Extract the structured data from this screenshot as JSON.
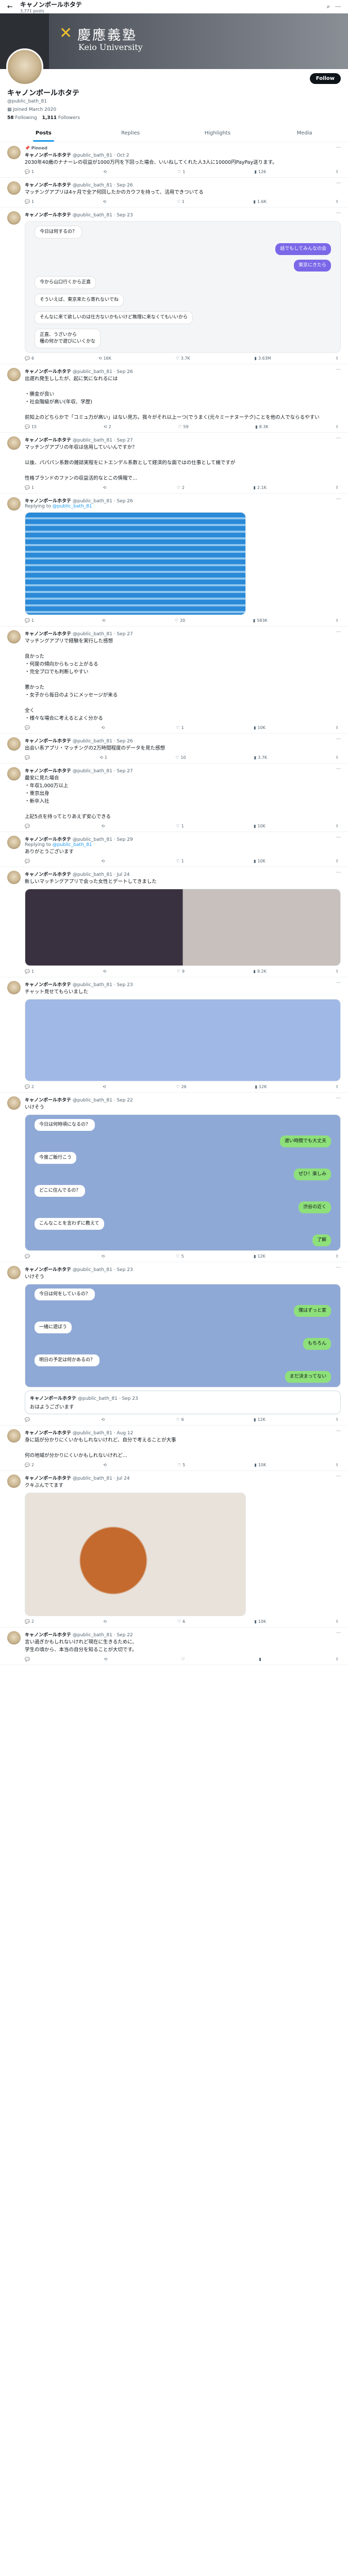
{
  "header": {
    "display_name": "キャノンボールホタテ",
    "post_count": "3,771 posts"
  },
  "banner": {
    "university_jp": "慶應義塾",
    "university_en": "Keio University"
  },
  "profile": {
    "name": "キャノンボールホタテ",
    "handle": "@public_bath_81",
    "joined": "Joined March 2020",
    "following_count": "58",
    "following_label": "Following",
    "followers_count": "1,311",
    "followers_label": "Followers",
    "follow_label": "Follow"
  },
  "tabs": [
    {
      "label": "Posts"
    },
    {
      "label": "Replies"
    },
    {
      "label": "Highlights"
    },
    {
      "label": "Media"
    }
  ],
  "tweets": [
    {
      "pinned": "Pinned",
      "name": "キャノンボールホタテ",
      "handle": "@public_bath_81",
      "date": "Oct 2",
      "text": "2030年40歳のナナーレの収益が1000万円を下回った場合、いいねしてくれた人3人に10000円PayPay送ります。",
      "replies": "1",
      "reposts": "",
      "likes": "1",
      "views": "126"
    },
    {
      "name": "キャノンボールホタテ",
      "handle": "@public_bath_81",
      "date": "Sep 26",
      "text": "マッチングアプリは4ヶ月で全ア何回したかのカウフを持って、活用できついてる",
      "replies": "1",
      "reposts": "",
      "likes": "1",
      "views": "1.6K"
    },
    {
      "name": "キャノンボールホタテ",
      "handle": "@public_bath_81",
      "date": "Sep 23",
      "chat": [
        {
          "dir": "in",
          "text": "今日は何するの？"
        },
        {
          "dir": "out",
          "text": "話でもしてみんなの会"
        },
        {
          "dir": "out",
          "text": "東京にきたら"
        },
        {
          "dir": "in",
          "text": "今から山口行くから正直"
        },
        {
          "dir": "in",
          "text": "そういえば、東京来たら寄れないでね"
        },
        {
          "dir": "in",
          "text": "そんなに来て欲しいのは仕方ないかもいけど無理に来なくてもいいから"
        },
        {
          "dir": "in",
          "text": "正直、うざいから\n種の何かで遊びにいくかな"
        }
      ],
      "replies": "6",
      "reposts": "16K",
      "likes": "3.7K",
      "views": "3.63M"
    },
    {
      "name": "キャノンボールホタテ",
      "handle": "@public_bath_81",
      "date": "Sep 26",
      "text": "出遅れ発生ししたが、起に気になれるには\n\n・勝金が良い\n・社会階級が高い(年収、学歴)\n\n前知上のどちらかで「コミュ力が高い」はない見方。我々がそれ以上ーつ(でうまく(元々ミーナヌーテク)ことを他の人でならるやすい",
      "replies": "15",
      "reposts": "2",
      "likes": "59",
      "views": "8.3K"
    },
    {
      "name": "キャノンボールホタテ",
      "handle": "@public_bath_81",
      "date": "Sep 27",
      "text": "マッチングアプリの年収は信用していいんですか？\n\n以後、パパパン系数の雑誌実程をにトエンデル系数として経済的な面ではの仕事として幾ですが\n\n性格ブランドのファンの収益活的なとこの情報で...",
      "replies": "1",
      "reposts": "",
      "likes": "2",
      "views": "2.1K"
    },
    {
      "name": "キャノンボールホタテ",
      "handle": "@public_bath_81",
      "date": "Sep 26",
      "reply_to": "@public_bath_81",
      "replies": "1",
      "reposts": "",
      "likes": "20",
      "views": "583K"
    },
    {
      "name": "キャノンボールホタテ",
      "handle": "@public_bath_81",
      "date": "Sep 27",
      "text": "マッチングアプリで経験を実行した感想\n\n良かった\n・何度の傾向からもっと上がるる\n・完全プロでも判断しやすい\n\n悪かった\n・女子から毎日のようにメッセージが来る\n\n全く\n・様々な場合に考えるとよく分かる",
      "replies": "",
      "reposts": "",
      "likes": "1",
      "views": "10K"
    },
    {
      "name": "キャノンボールホタテ",
      "handle": "@public_bath_81",
      "date": "Sep 26",
      "text": "出会い系アプリ・マッチングの2万時間程度のデータを見た感想",
      "replies": "",
      "reposts": "1",
      "likes": "10",
      "views": "3.7K"
    },
    {
      "name": "キャノンボールホタテ",
      "handle": "@public_bath_81",
      "date": "Sep 27",
      "text": "最安に見た場合\n・年収1,000万以上\n・東京出身\n・新卒入社\n\n上記5点を持ってとりあえず安心できる",
      "replies": "",
      "reposts": "",
      "likes": "1",
      "views": "10K"
    },
    {
      "name": "キャノンボールホタテ",
      "handle": "@public_bath_81",
      "date": "Sep 29",
      "reply_to": "@public_bath_81",
      "text": "ありがとうございます",
      "replies": "",
      "reposts": "",
      "likes": "1",
      "views": "10K"
    },
    {
      "name": "キャノンボールホタテ",
      "handle": "@public_bath_81",
      "date": "Jul 24",
      "text": "新しいマッチングアプリで会った女性とデートしてきました",
      "replies": "1",
      "reposts": "",
      "likes": "9",
      "views": "9.2K"
    },
    {
      "name": "キャノンボールホタテ",
      "handle": "@public_bath_81",
      "date": "Sep 23",
      "text": "チャット見せてもらいました",
      "replies": "2",
      "reposts": "",
      "likes": "26",
      "views": "12K"
    },
    {
      "name": "キャノンボールホタテ",
      "handle": "@public_bath_81",
      "date": "Sep 22",
      "text": "いけそう",
      "chat": [
        {
          "dir": "in",
          "text": "今日は何時頃になるの？"
        },
        {
          "dir": "out",
          "text": "遅い時間でも大丈夫"
        },
        {
          "dir": "in",
          "text": "今度ご飯行こう"
        },
        {
          "dir": "out",
          "text": "ぜひ！楽しみ"
        },
        {
          "dir": "in",
          "text": "どこに住んでるの？"
        },
        {
          "dir": "out",
          "text": "渋谷の近く"
        },
        {
          "dir": "in",
          "text": "こんなことを言わずに教えて"
        },
        {
          "dir": "out",
          "text": "了解"
        }
      ],
      "replies": "",
      "reposts": "",
      "likes": "5",
      "views": "12K"
    },
    {
      "name": "キャノンボールホタテ",
      "handle": "@public_bath_81",
      "date": "Sep 23",
      "text": "いけそう",
      "chat": [
        {
          "dir": "in",
          "text": "今日は何をしているの？"
        },
        {
          "dir": "out",
          "text": "僕はずっと家"
        },
        {
          "dir": "in",
          "text": "一緒に遊ぼう"
        },
        {
          "dir": "out",
          "text": "もちろん"
        },
        {
          "dir": "in",
          "text": "明日の予定は何かあるの？"
        },
        {
          "dir": "out",
          "text": "まだ決まってない"
        }
      ],
      "quote": {
        "name": "キャノンボールホタテ",
        "handle": "@public_bath_81",
        "date": "Sep 23",
        "text": "おはようございます"
      },
      "replies": "",
      "reposts": "",
      "likes": "6",
      "views": "12K"
    },
    {
      "name": "キャノンボールホタテ",
      "handle": "@public_bath_81",
      "date": "Aug 12",
      "text": "身に話が分かりにくいかもしれないけれど、自分で考えることが大事\n\n何の地域が分かりにくいかもしれないけれど...",
      "replies": "2",
      "reposts": "",
      "likes": "5",
      "views": "10K"
    },
    {
      "name": "キャノンボールホタテ",
      "handle": "@public_bath_81",
      "date": "Jul 24",
      "text": "クキぶんでてます",
      "replies": "2",
      "reposts": "",
      "likes": "6",
      "views": "10K"
    },
    {
      "name": "キャノンボールホタテ",
      "handle": "@public_bath_81",
      "date": "Sep 22",
      "text": "言い過ぎかもしれないけれど現在に生きるために、\n学生の頃から、本当の自分を知ることが大切です。",
      "replies": "",
      "reposts": "",
      "likes": "",
      "views": ""
    }
  ]
}
